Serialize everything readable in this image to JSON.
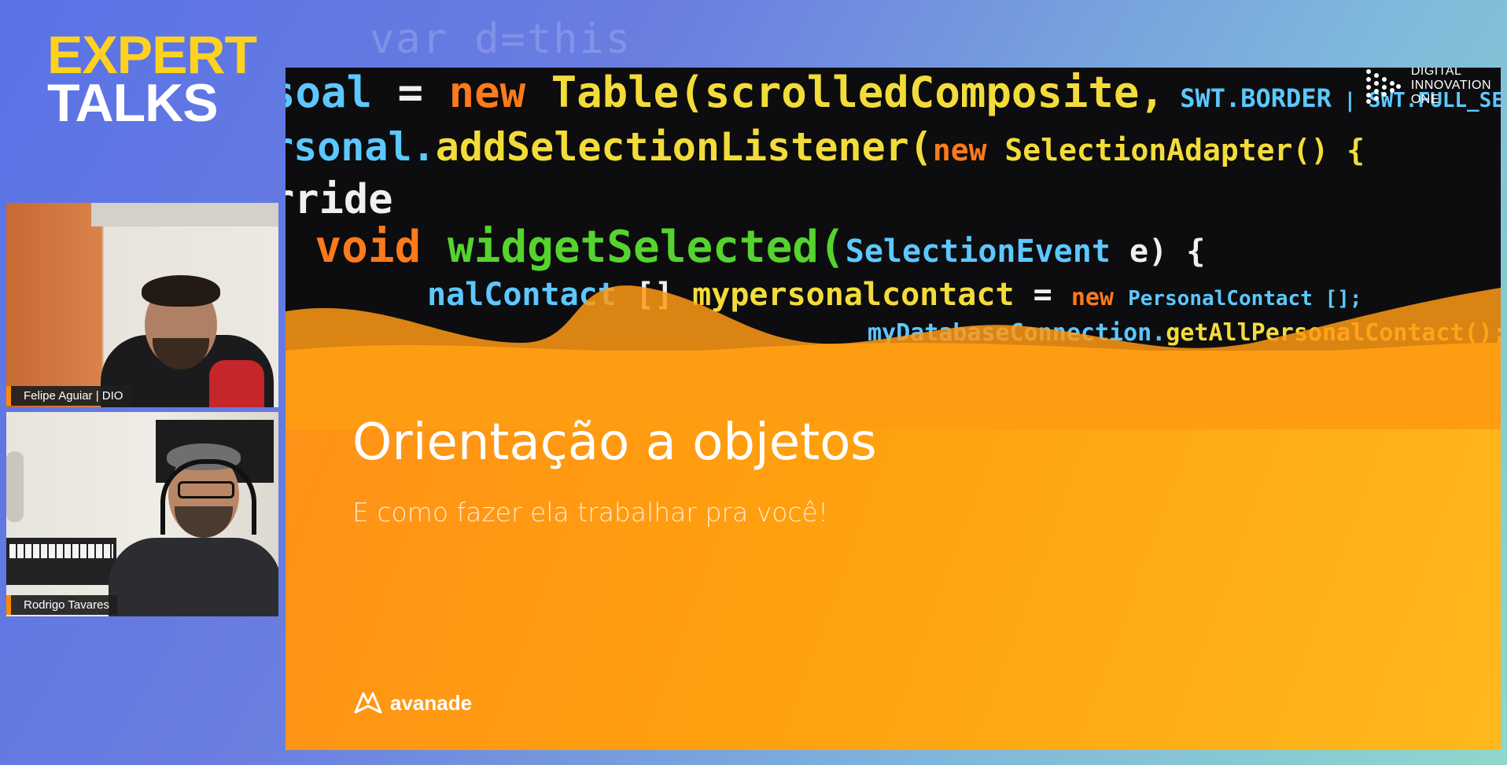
{
  "background": {
    "faint_code": "var d=this"
  },
  "event_logo": {
    "line1": "EXPERT",
    "line2": "TALKS"
  },
  "participants": [
    {
      "name": "Felipe Aguiar | DIO"
    },
    {
      "name": "Rodrigo Tavares"
    }
  ],
  "slide": {
    "code_lines": [
      {
        "parts": [
          "soal",
          " = ",
          "new ",
          "Table(",
          "scrolledComposite,",
          " SWT.BORDER",
          " | SWT.FULL_SELECTION);"
        ]
      },
      {
        "parts": [
          "rsonal.",
          "addSelectionListener(",
          "new ",
          "SelectionAdapter() {"
        ]
      },
      {
        "parts": [
          "rride"
        ]
      },
      {
        "parts": [
          "c void ",
          "widgetSelected(",
          "SelectionEvent ",
          "e) {"
        ]
      },
      {
        "parts": [
          "nalContact",
          " []",
          " mypersonalcontact",
          " = ",
          "new ",
          "PersonalContact [];"
        ]
      },
      {
        "parts": [
          "myDatabaseConnection.",
          "getAllPersonalContact();"
        ]
      }
    ],
    "title": "Orientação a objetos",
    "subtitle": "E como fazer ela trabalhar pra você!",
    "brand": "avanade",
    "partner_logo": [
      "DIGITAL",
      "INNOVATION",
      "ONE"
    ]
  },
  "colors": {
    "event_yellow": "#ffd21f",
    "slide_orange": "#ff9f0e",
    "name_tag_accent": "#ff8a00"
  }
}
